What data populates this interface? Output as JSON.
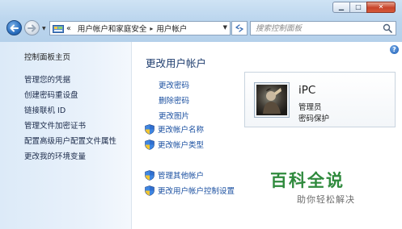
{
  "window": {
    "controls": {
      "minimize_icon": "minimize-icon",
      "maximize_icon": "maximize-icon",
      "close_icon": "close-icon"
    }
  },
  "toolbar": {
    "back_icon": "back-arrow-icon",
    "forward_icon": "forward-arrow-icon",
    "breadcrumb": [
      "«",
      "用户帐户和家庭安全",
      "用户帐户"
    ],
    "search_placeholder": "搜索控制面板"
  },
  "sidebar": {
    "home": "控制面板主页",
    "items": [
      "管理您的凭据",
      "创建密码重设盘",
      "链接联机 ID",
      "管理文件加密证书",
      "配置高级用户配置文件属性",
      "更改我的环境变量"
    ]
  },
  "main": {
    "heading": "更改用户帐户",
    "links": [
      "更改密码",
      "删除密码",
      "更改图片"
    ],
    "shield_links": [
      "更改帐户名称",
      "更改帐户类型"
    ],
    "shield_links_2": [
      "管理其他帐户",
      "更改用户帐户控制设置"
    ]
  },
  "user": {
    "name": "iPC",
    "role": "管理员",
    "protection": "密码保护"
  },
  "watermark": {
    "title": "百科全说",
    "subtitle": "助你轻松解决"
  },
  "colors": {
    "link": "#1a4fa0",
    "heading": "#1e3d6e",
    "sidebar_bg": "#dceaf8",
    "titlebar_bg": "#bcd6ee",
    "watermark_green": "#2f8a3d"
  }
}
